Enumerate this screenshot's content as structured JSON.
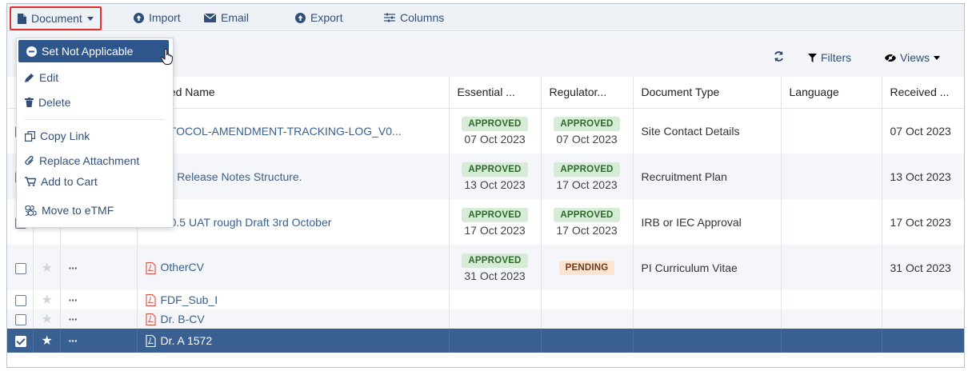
{
  "toolbar": {
    "document_label": "Document",
    "import_label": "Import",
    "email_label": "Email",
    "export_label": "Export",
    "columns_label": "Columns"
  },
  "filterbar": {
    "filters_label": "Filters",
    "views_label": "Views"
  },
  "menu": {
    "set_not_applicable": "Set Not Applicable",
    "edit": "Edit",
    "delete": "Delete",
    "copy_link": "Copy Link",
    "replace_attachment": "Replace Attachment",
    "add_to_cart": "Add to Cart",
    "move_to_etmf": "Move to eTMF"
  },
  "columns": {
    "submitted_name": "bmitted Name",
    "essential": "Essential ...",
    "regulatory": "Regulator...",
    "document_type": "Document Type",
    "language": "Language",
    "received": "Received ..."
  },
  "rows": [
    {
      "name": "PROTOCOL-AMENDMENT-TRACKING-LOG_V0...",
      "ess_status": "APPROVED",
      "ess_date": "07 Oct 2023",
      "reg_status": "APPROVED",
      "reg_date": "07 Oct 2023",
      "doc_type": "Site Contact Details",
      "language": "",
      "received": "07 Oct 2023"
    },
    {
      "name": "Patch Release Notes Structure.",
      "ess_status": "APPROVED",
      "ess_date": "13 Oct 2023",
      "reg_status": "APPROVED",
      "reg_date": "17 Oct 2023",
      "doc_type": "Recruitment Plan",
      "language": "",
      "received": "13 Oct 2023"
    },
    {
      "name": "TI v10.5 UAT rough Draft 3rd October",
      "ess_status": "APPROVED",
      "ess_date": "17 Oct 2023",
      "reg_status": "APPROVED",
      "reg_date": "17 Oct 2023",
      "doc_type": "IRB or IEC Approval",
      "language": "",
      "received": "17 Oct 2023"
    },
    {
      "name": "OtherCV",
      "ess_status": "APPROVED",
      "ess_date": "31 Oct 2023",
      "reg_status": "PENDING",
      "reg_date": "",
      "doc_type": "PI Curriculum Vitae",
      "language": "",
      "received": "31 Oct 2023"
    },
    {
      "name": "FDF_Sub_I"
    },
    {
      "name": "Dr. B-CV"
    },
    {
      "name": "Dr. A 1572"
    }
  ],
  "row_actions_glyph": "···",
  "colors": {
    "accent": "#2f568c",
    "selected_row": "#3a6092",
    "highlight_border": "#e0322c",
    "approved_bg": "#d7ecd6",
    "pending_bg": "#fbe4d2"
  }
}
